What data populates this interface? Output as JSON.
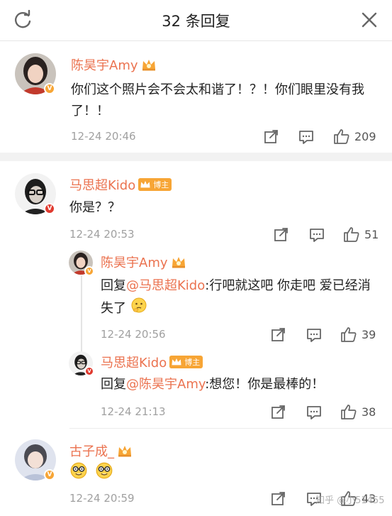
{
  "header": {
    "title": "32 条回复",
    "refresh_icon": "refresh-icon",
    "close_icon": "close-icon"
  },
  "colors": {
    "name_orange": "#eb7350",
    "verified_orange": "#f7a535",
    "verified_red": "#e03a2f",
    "verified_blue": "#3ba1e8",
    "muted": "#a0a0a0"
  },
  "comments": [
    {
      "author": "陈昊宇Amy",
      "badge": "crown-icon",
      "text": "你们这个照片会不会太和谐了！？！你们眼里没有我了！！",
      "time": "12-24 20:46",
      "likes": "209"
    },
    {
      "author": "马思超Kido",
      "badge": "crown-icon",
      "tag": "博主",
      "text": "你是？？",
      "time": "12-24 20:53",
      "likes": "51",
      "replies": [
        {
          "author": "陈昊宇Amy",
          "prefix": "回复",
          "mention": "@马思超Kido",
          "text": ":行吧就这吧 你走吧 爱已经消失了",
          "emoji": "thinking-emoji",
          "time": "12-24 20:56",
          "likes": "39"
        },
        {
          "author": "马思超Kido",
          "tag": "博主",
          "prefix": "回复",
          "mention": "@陈昊宇Amy",
          "text": ":想您！你是最棒的！",
          "time": "12-24 21:13",
          "likes": "38"
        }
      ]
    },
    {
      "author": "古子成_",
      "badge": "crown-icon",
      "text": "",
      "emojis": [
        "nerd-emoji",
        "nerd-emoji"
      ],
      "time": "12-24 20:59",
      "likes": "43"
    }
  ],
  "watermark": "知乎 @小51455"
}
